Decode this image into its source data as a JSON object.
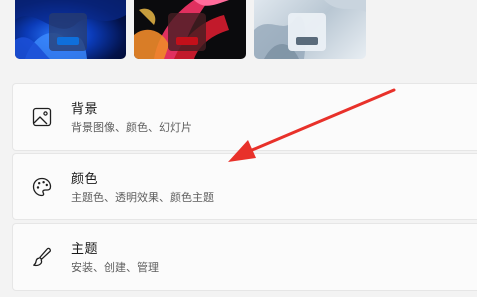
{
  "wallpapers": [
    {
      "swatch_color": "#0f6fdb",
      "theme": "blue"
    },
    {
      "swatch_color": "#c3101a",
      "theme": "red"
    },
    {
      "swatch_color": "#5a6b7b",
      "theme": "gray"
    }
  ],
  "settings": {
    "background": {
      "title": "背景",
      "subtitle": "背景图像、颜色、幻灯片",
      "icon": "image-icon"
    },
    "colors": {
      "title": "颜色",
      "subtitle": "主题色、透明效果、颜色主题",
      "icon": "palette-icon"
    },
    "themes": {
      "title": "主题",
      "subtitle": "安装、创建、管理",
      "icon": "brush-icon"
    }
  },
  "annotation": {
    "arrow_color": "#e8312a"
  }
}
